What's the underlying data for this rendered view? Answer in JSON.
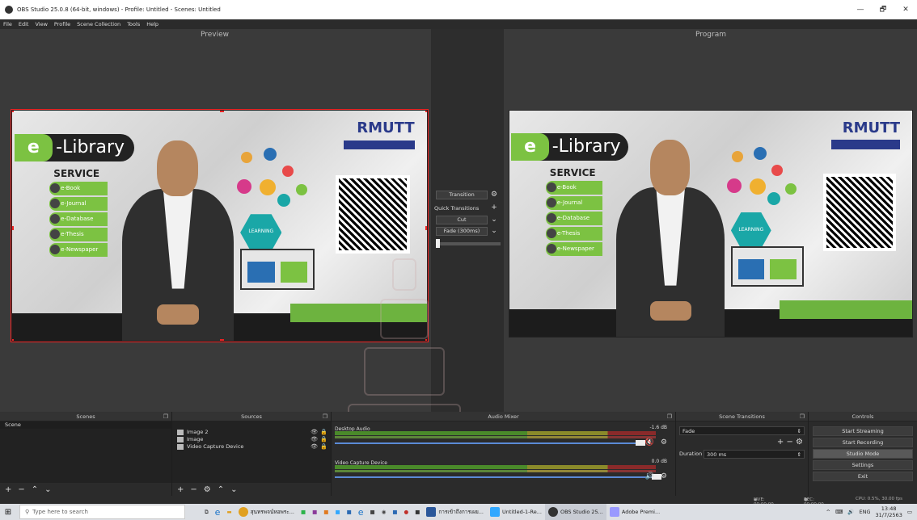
{
  "window": {
    "title": "OBS Studio 25.0.8 (64-bit, windows) - Profile: Untitled - Scenes: Untitled",
    "controls": [
      "—",
      "🗗",
      "✕"
    ]
  },
  "menu": [
    "File",
    "Edit",
    "View",
    "Profile",
    "Scene Collection",
    "Tools",
    "Help"
  ],
  "preview_label": "Preview",
  "program_label": "Program",
  "scene_content": {
    "banner_e": "e",
    "banner_rest": "-Library",
    "service_title": "SERVICE",
    "services": [
      "e-Book",
      "e-Journal",
      "e-Database",
      "e-Thesis",
      "e-Newspaper"
    ],
    "logo": "RMUTT",
    "learning": "LEARNING",
    "colors": {
      "green": "#7cc242",
      "teal": "#1aa7a7",
      "navy": "#2a3a8a",
      "selection": "#ee2222"
    }
  },
  "transition": {
    "transition_button": "Transition",
    "quick_transitions": "Quick Transitions",
    "cut": "Cut",
    "fade": "Fade (300ms)"
  },
  "docks": {
    "scenes": {
      "title": "Scenes",
      "items": [
        "Scene"
      ]
    },
    "sources": {
      "title": "Sources",
      "items": [
        "Image 2",
        "Image",
        "Video Capture Device"
      ]
    },
    "audio_mixer": {
      "title": "Audio Mixer",
      "tracks": [
        {
          "name": "Desktop Audio",
          "db": "-1.6 dB",
          "muted": true
        },
        {
          "name": "Video Capture Device",
          "db": "0.0 dB",
          "muted": false
        }
      ]
    },
    "scene_transitions": {
      "title": "Scene Transitions",
      "selected": "Fade",
      "duration_label": "Duration",
      "duration_value": "300 ms"
    },
    "controls": {
      "title": "Controls",
      "buttons": [
        "Start Streaming",
        "Start Recording",
        "Studio Mode",
        "Settings",
        "Exit"
      ]
    }
  },
  "statusbar": {
    "live": "LIVE: 00:00:00",
    "rec": "REC: 00:00:00",
    "cpu": "CPU: 0.5%, 30.00 fps"
  },
  "taskbar": {
    "search_placeholder": "Type here to search",
    "apps": [
      {
        "label": "สุนทรพจน์หอพระ...",
        "color": "#e0a020"
      },
      {
        "label": "การเข้าถึงการเผย...",
        "color": "#2b579a"
      },
      {
        "label": "Untitled-1-Re...",
        "color": "#31a8ff"
      },
      {
        "label": "OBS Studio 25...",
        "color": "#333333"
      },
      {
        "label": "Adobe Premi...",
        "color": "#9999ff"
      }
    ],
    "tray": {
      "lang": "ENG",
      "time": "13:48",
      "date": "31/7/2563"
    }
  }
}
